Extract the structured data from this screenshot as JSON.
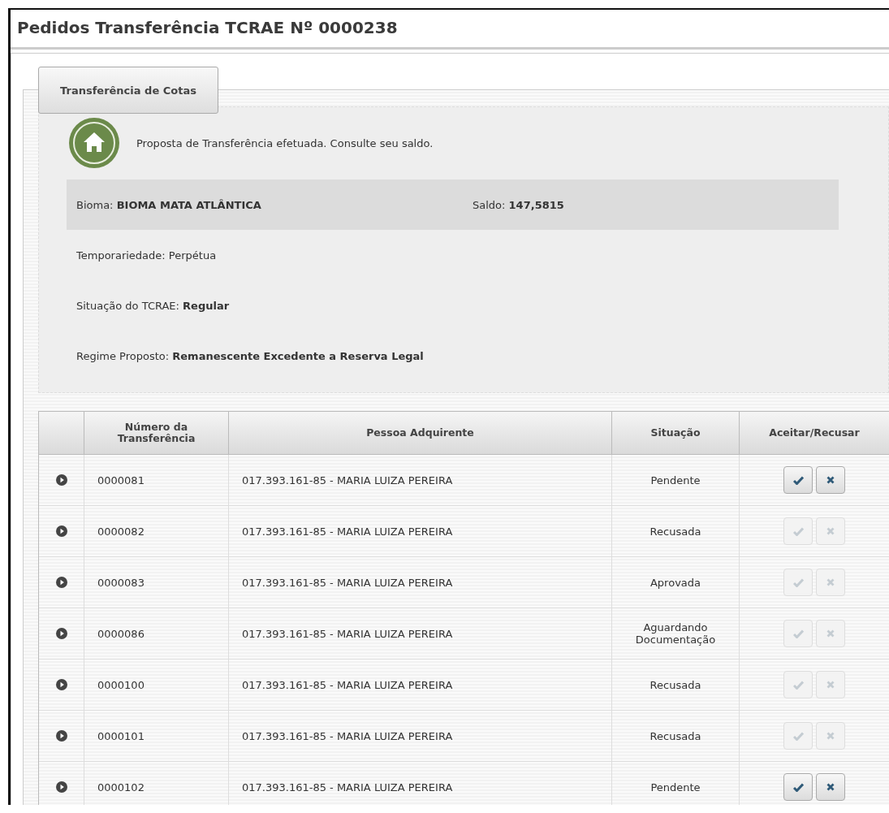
{
  "window": {
    "title": "Pedidos Transferência TCRAE Nº 0000238"
  },
  "tabs": [
    {
      "label": "Transferência de Cotas",
      "selected": true
    }
  ],
  "message": "Proposta de Transferência efetuada. Consulte seu saldo.",
  "summary": {
    "bioma": "Bioma: **BIOMA MATA ATLÂNTICA**",
    "saldo": "Saldo: **147,5815**"
  },
  "details": [
    "Temporariedade: Perpétua",
    "Situação do TCRAE: **Regular**",
    "Regime Proposto: **Remanescente Excedente a Reserva Legal**"
  ],
  "table": {
    "columns": [
      "Número da Transferência",
      "Pessoa Adquirente",
      "Situação",
      "Aceitar/Recusar"
    ],
    "rows": [
      {
        "numero": "0000081",
        "pessoa": "017.393.161-85 - MARIA LUIZA PEREIRA",
        "situacao": "Pendente",
        "disabled": false
      },
      {
        "numero": "0000082",
        "pessoa": "017.393.161-85 - MARIA LUIZA PEREIRA",
        "situacao": "Recusada",
        "disabled": true
      },
      {
        "numero": "0000083",
        "pessoa": "017.393.161-85 - MARIA LUIZA PEREIRA",
        "situacao": "Aprovada",
        "disabled": true
      },
      {
        "numero": "0000086",
        "pessoa": "017.393.161-85 - MARIA LUIZA PEREIRA",
        "situacao": "Aguardando Documentação",
        "disabled": true
      },
      {
        "numero": "0000100",
        "pessoa": "017.393.161-85 - MARIA LUIZA PEREIRA",
        "situacao": "Recusada",
        "disabled": true
      },
      {
        "numero": "0000101",
        "pessoa": "017.393.161-85 - MARIA LUIZA PEREIRA",
        "situacao": "Recusada",
        "disabled": true
      },
      {
        "numero": "0000102",
        "pessoa": "017.393.161-85 - MARIA LUIZA PEREIRA",
        "situacao": "Pendente",
        "disabled": false
      }
    ]
  }
}
